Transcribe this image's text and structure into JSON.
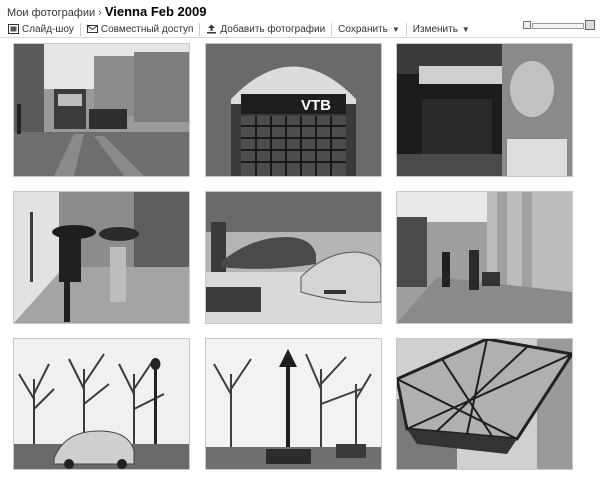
{
  "header": {
    "breadcrumb": "Мои фотографии",
    "separator": "›",
    "album_title": "Vienna Feb 2009"
  },
  "toolbar": {
    "slideshow": "Слайд-шоу",
    "share": "Совместный доступ",
    "add_photos": "Добавить фотографии",
    "save": "Сохранить",
    "edit": "Изменить"
  },
  "photos": [
    {
      "scene": "tram-street"
    },
    {
      "scene": "vtb-bank-arch"
    },
    {
      "scene": "cinema-poster"
    },
    {
      "scene": "umbrella-pedestrians"
    },
    {
      "scene": "car-showroom"
    },
    {
      "scene": "rainy-sidewalk"
    },
    {
      "scene": "bare-trees-car"
    },
    {
      "scene": "street-lamp-trees"
    },
    {
      "scene": "glass-canopy"
    }
  ]
}
